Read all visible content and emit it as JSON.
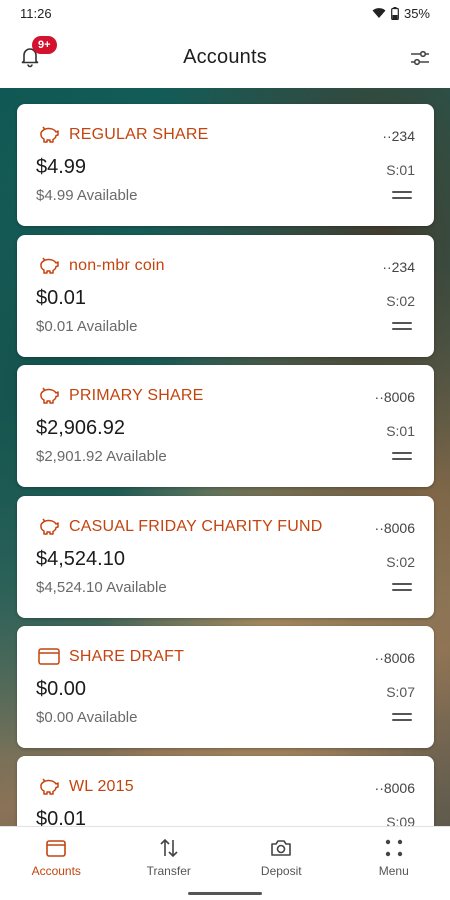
{
  "status_bar": {
    "time": "11:26",
    "battery": "35%"
  },
  "header": {
    "title": "Accounts",
    "notification_badge": "9+"
  },
  "accounts": [
    {
      "icon": "piggy-bank-icon",
      "name": "REGULAR SHARE",
      "mask": "··234",
      "balance": "$4.99",
      "suffix": "S:01",
      "available": "$4.99 Available"
    },
    {
      "icon": "piggy-bank-icon",
      "name": "non-mbr coin",
      "mask": "··234",
      "balance": "$0.01",
      "suffix": "S:02",
      "available": "$0.01 Available"
    },
    {
      "icon": "piggy-bank-icon",
      "name": "PRIMARY SHARE",
      "mask": "··8006",
      "balance": "$2,906.92",
      "suffix": "S:01",
      "available": "$2,901.92 Available"
    },
    {
      "icon": "piggy-bank-icon",
      "name": "CASUAL FRIDAY CHARITY FUND",
      "mask": "··8006",
      "balance": "$4,524.10",
      "suffix": "S:02",
      "available": "$4,524.10 Available"
    },
    {
      "icon": "wallet-icon",
      "name": "SHARE DRAFT",
      "mask": "··8006",
      "balance": "$0.00",
      "suffix": "S:07",
      "available": "$0.00 Available"
    },
    {
      "icon": "piggy-bank-icon",
      "name": "WL 2015",
      "mask": "··8006",
      "balance": "$0.01",
      "suffix": "S:09",
      "available": ""
    }
  ],
  "bottom_nav": [
    {
      "label": "Accounts",
      "icon": "wallet-icon",
      "active": true
    },
    {
      "label": "Transfer",
      "icon": "transfer-arrows-icon",
      "active": false
    },
    {
      "label": "Deposit",
      "icon": "camera-icon",
      "active": false
    },
    {
      "label": "Menu",
      "icon": "dots-grid-icon",
      "active": false
    }
  ],
  "colors": {
    "accent": "#c4440f",
    "badge": "#d2122e"
  }
}
